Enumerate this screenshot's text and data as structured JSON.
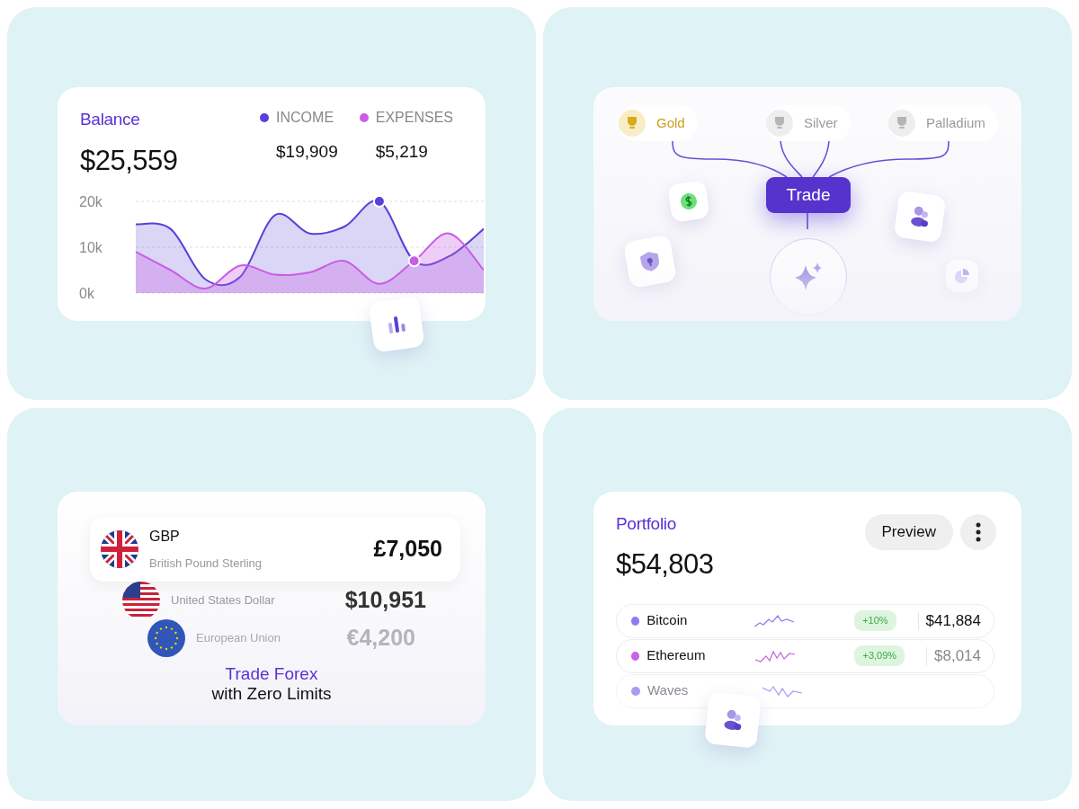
{
  "balance": {
    "title": "Balance",
    "amount": "$25,559",
    "legend": [
      {
        "amount": "$19,909"
      },
      {
        "amount": "$5,219"
      }
    ],
    "chart_data": {
      "type": "area",
      "stacked": false,
      "yticks": [
        {
          "value": 0,
          "label": "0k"
        },
        {
          "value": 10,
          "label": "10k"
        },
        {
          "value": 20,
          "label": "20k"
        }
      ],
      "ylim": [
        0,
        20
      ],
      "series": [
        {
          "name": "INCOME",
          "color": "#5a3fd8",
          "values": [
            15,
            14,
            3,
            3.5,
            17,
            13,
            14.5,
            20,
            7,
            8,
            14
          ]
        },
        {
          "name": "EXPENSES",
          "color": "#c85ce6",
          "values": [
            9,
            5,
            1,
            6,
            4,
            4.5,
            7,
            2,
            7,
            13,
            5
          ]
        }
      ]
    }
  },
  "trade": {
    "metals": [
      {
        "label": "Gold",
        "selected": true
      },
      {
        "label": "Silver",
        "selected": false
      },
      {
        "label": "Palladium",
        "selected": false
      }
    ],
    "button": "Trade"
  },
  "forex": {
    "currencies": [
      {
        "kind": "gbp",
        "code": "GBP",
        "name": "British Pound Sterling",
        "amount": "£7,050"
      },
      {
        "kind": "usd",
        "name": "United States Dollar",
        "amount": "$10,951"
      },
      {
        "kind": "eur",
        "name": "European Union",
        "amount": "€4,200"
      }
    ],
    "headline": "Trade Forex",
    "subline": "with Zero Limits"
  },
  "portfolio": {
    "title": "Portfolio",
    "amount": "$54,803",
    "button": "Preview",
    "assets": [
      {
        "name": "Bitcoin",
        "color": "#8c7cf4",
        "change": "+10%",
        "value": "$41,884"
      },
      {
        "name": "Ethereum",
        "color": "#c964e2",
        "change": "+3,09%",
        "value": "$8,014"
      },
      {
        "name": "Waves",
        "color": "#a89cf0"
      }
    ]
  }
}
